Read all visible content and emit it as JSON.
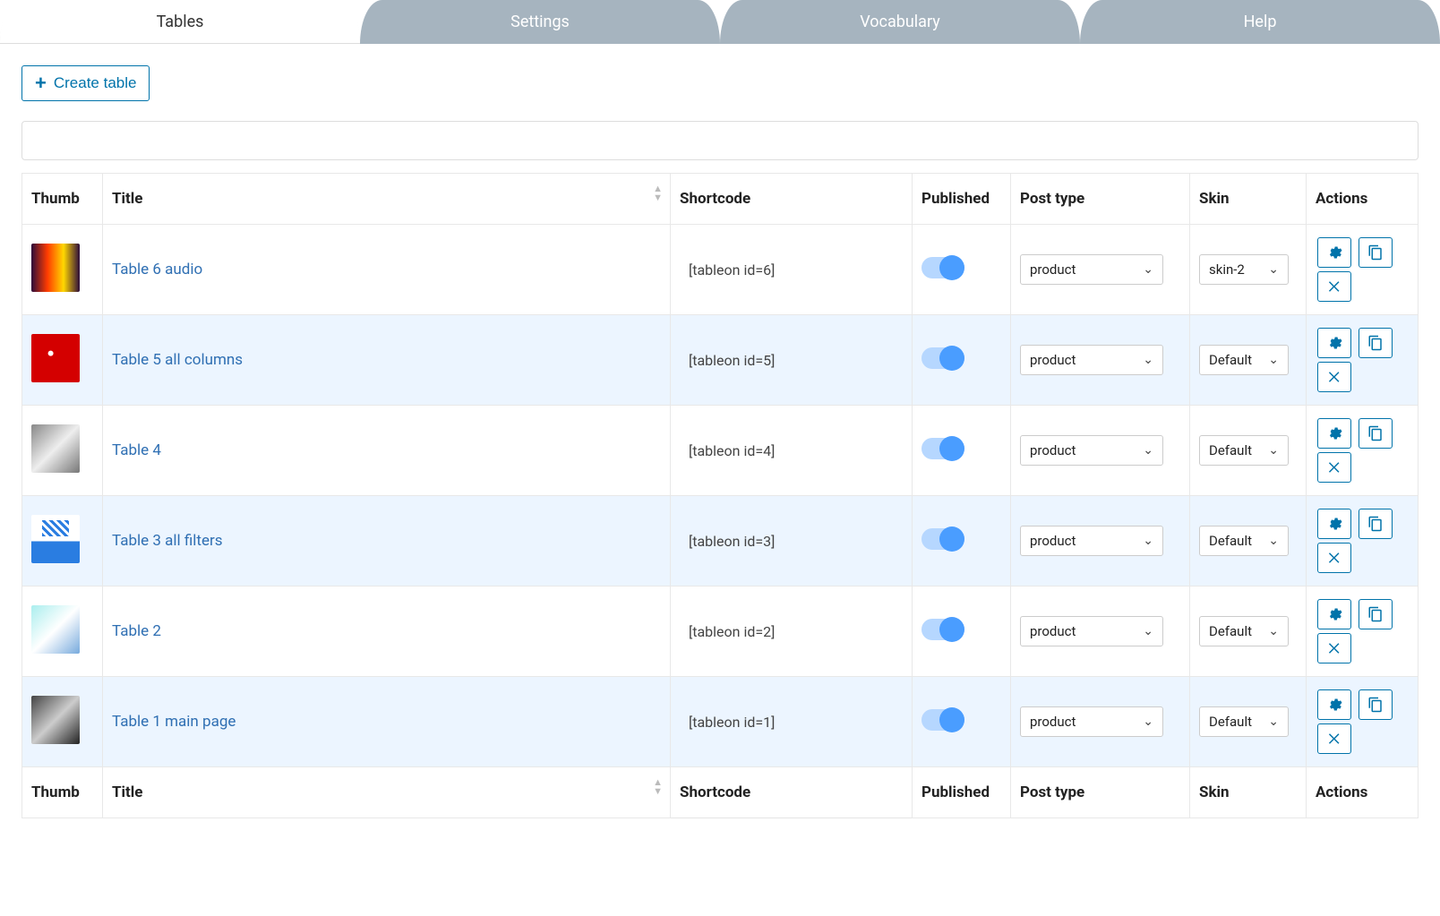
{
  "tabs": [
    "Tables",
    "Settings",
    "Vocabulary",
    "Help"
  ],
  "active_tab": 0,
  "create_button": "Create table",
  "search_placeholder": "",
  "columns": {
    "thumb": "Thumb",
    "title": "Title",
    "shortcode": "Shortcode",
    "published": "Published",
    "post_type": "Post type",
    "skin": "Skin",
    "actions": "Actions"
  },
  "rows": [
    {
      "title": "Table 6 audio",
      "shortcode": "[tableon id=6]",
      "published": true,
      "post_type": "product",
      "skin": "skin-2",
      "thumb": "audio"
    },
    {
      "title": "Table 5 all columns",
      "shortcode": "[tableon id=5]",
      "published": true,
      "post_type": "product",
      "skin": "Default",
      "thumb": "redshoe"
    },
    {
      "title": "Table 4",
      "shortcode": "[tableon id=4]",
      "published": true,
      "post_type": "product",
      "skin": "Default",
      "thumb": "shoe1"
    },
    {
      "title": "Table 3 all filters",
      "shortcode": "[tableon id=3]",
      "published": true,
      "post_type": "product",
      "skin": "Default",
      "thumb": "adidas"
    },
    {
      "title": "Table 2",
      "shortcode": "[tableon id=2]",
      "published": true,
      "post_type": "product",
      "skin": "Default",
      "thumb": "shoe2"
    },
    {
      "title": "Table 1 main page",
      "shortcode": "[tableon id=1]",
      "published": true,
      "post_type": "product",
      "skin": "Default",
      "thumb": "shoe3"
    }
  ]
}
